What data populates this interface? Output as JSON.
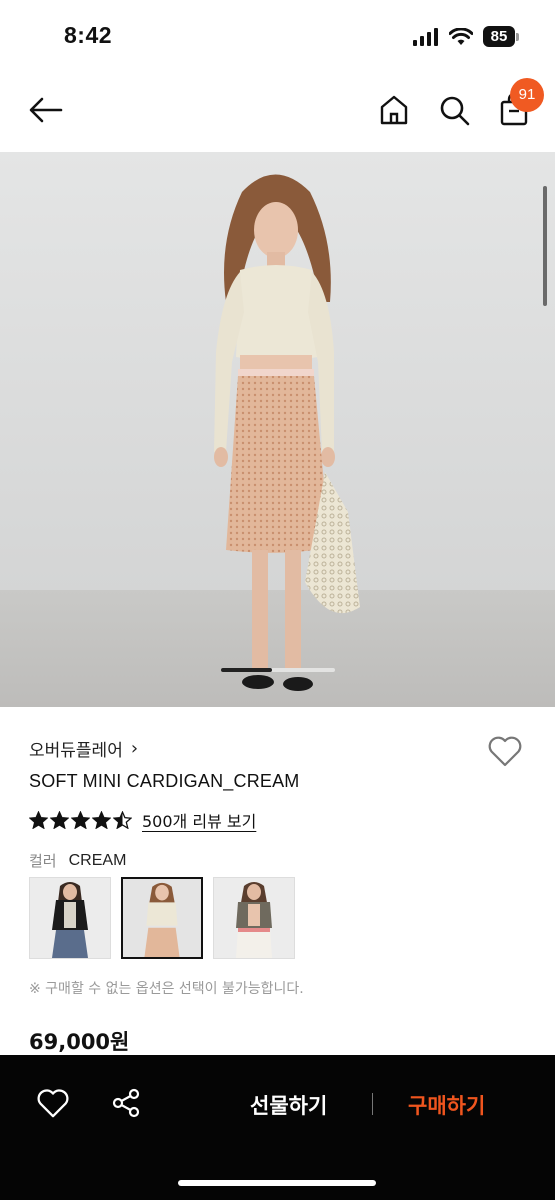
{
  "status_bar": {
    "time": "8:42",
    "battery": "85",
    "icons": [
      "cellular-signal-icon",
      "wifi-icon",
      "battery-icon"
    ]
  },
  "header": {
    "icons": [
      "back-arrow-icon",
      "home-icon",
      "search-icon",
      "cart-icon"
    ],
    "cart_count": "91",
    "badge_color": "#f05a22"
  },
  "product": {
    "brand": "오버듀플레어",
    "brand_chevron": "›",
    "name": "SOFT MINI CARDIGAN_CREAM",
    "rating": 4.5,
    "rating_max": 5,
    "review_link": "500개 리뷰 보기",
    "color_label": "컬러",
    "color_value": "CREAM",
    "color_options": [
      {
        "name": "black",
        "selected": false
      },
      {
        "name": "cream",
        "selected": true
      },
      {
        "name": "khaki",
        "selected": false
      }
    ],
    "notice": "※ 구매할 수 없는 옵션은 선택이 불가능합니다.",
    "price": "69,000원"
  },
  "image_pager": {
    "current": 1,
    "progress": 0.45
  },
  "bottom_bar": {
    "gift_label": "선물하기",
    "buy_label": "구매하기",
    "buy_color": "#f0551e",
    "icons": [
      "heart-icon",
      "share-icon"
    ]
  }
}
